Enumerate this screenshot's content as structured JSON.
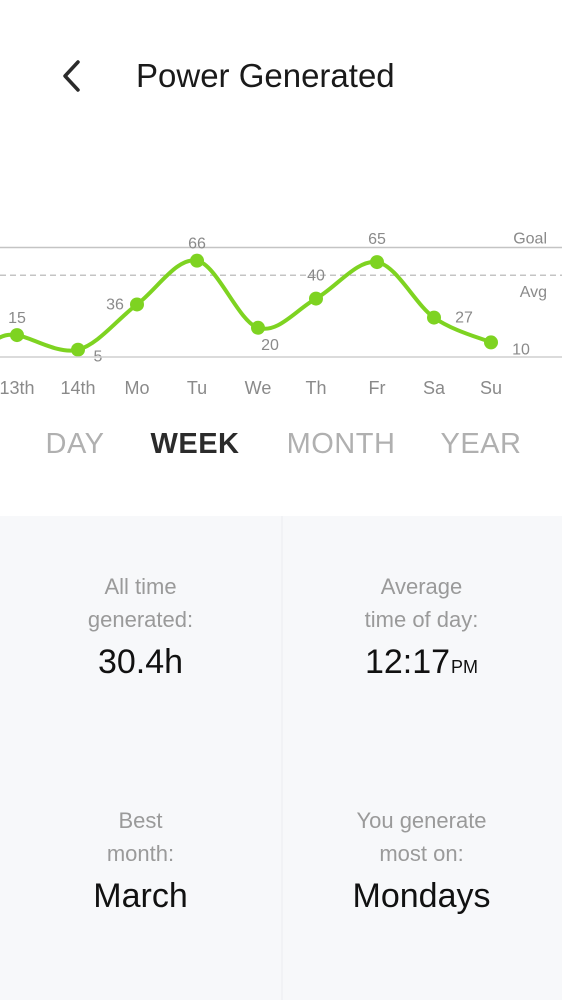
{
  "header": {
    "title": "Power Generated",
    "back_icon": "chevron-left-icon"
  },
  "chart_data": {
    "type": "line",
    "x": [
      "13th",
      "14th",
      "Mo",
      "Tu",
      "We",
      "Th",
      "Fr",
      "Sa",
      "Su"
    ],
    "series": [
      {
        "values": [
          15,
          5,
          36,
          66,
          20,
          40,
          65,
          27,
          10
        ]
      }
    ],
    "reference_lines": [
      {
        "label": "Goal",
        "value": 75,
        "style": "solid"
      },
      {
        "label": "Avg",
        "value": 56,
        "style": "dashed"
      }
    ],
    "ylim": [
      0,
      100
    ],
    "grid": false,
    "line_color": "#7ed321"
  },
  "tabs": [
    {
      "label": "DAY",
      "active": false
    },
    {
      "label": "WEEK",
      "active": true
    },
    {
      "label": "MONTH",
      "active": false
    },
    {
      "label": "YEAR",
      "active": false
    }
  ],
  "stats": {
    "all_time": {
      "label_line1": "All time",
      "label_line2": "generated:",
      "value": "30.4h"
    },
    "avg_time": {
      "label_line1": "Average",
      "label_line2": "time of day:",
      "value": "12:17",
      "unit": "PM"
    },
    "best_month": {
      "label_line1": "Best",
      "label_line2": "month:",
      "value": "March"
    },
    "most_day": {
      "label_line1": "You generate",
      "label_line2": "most on:",
      "value": "Mondays"
    }
  }
}
